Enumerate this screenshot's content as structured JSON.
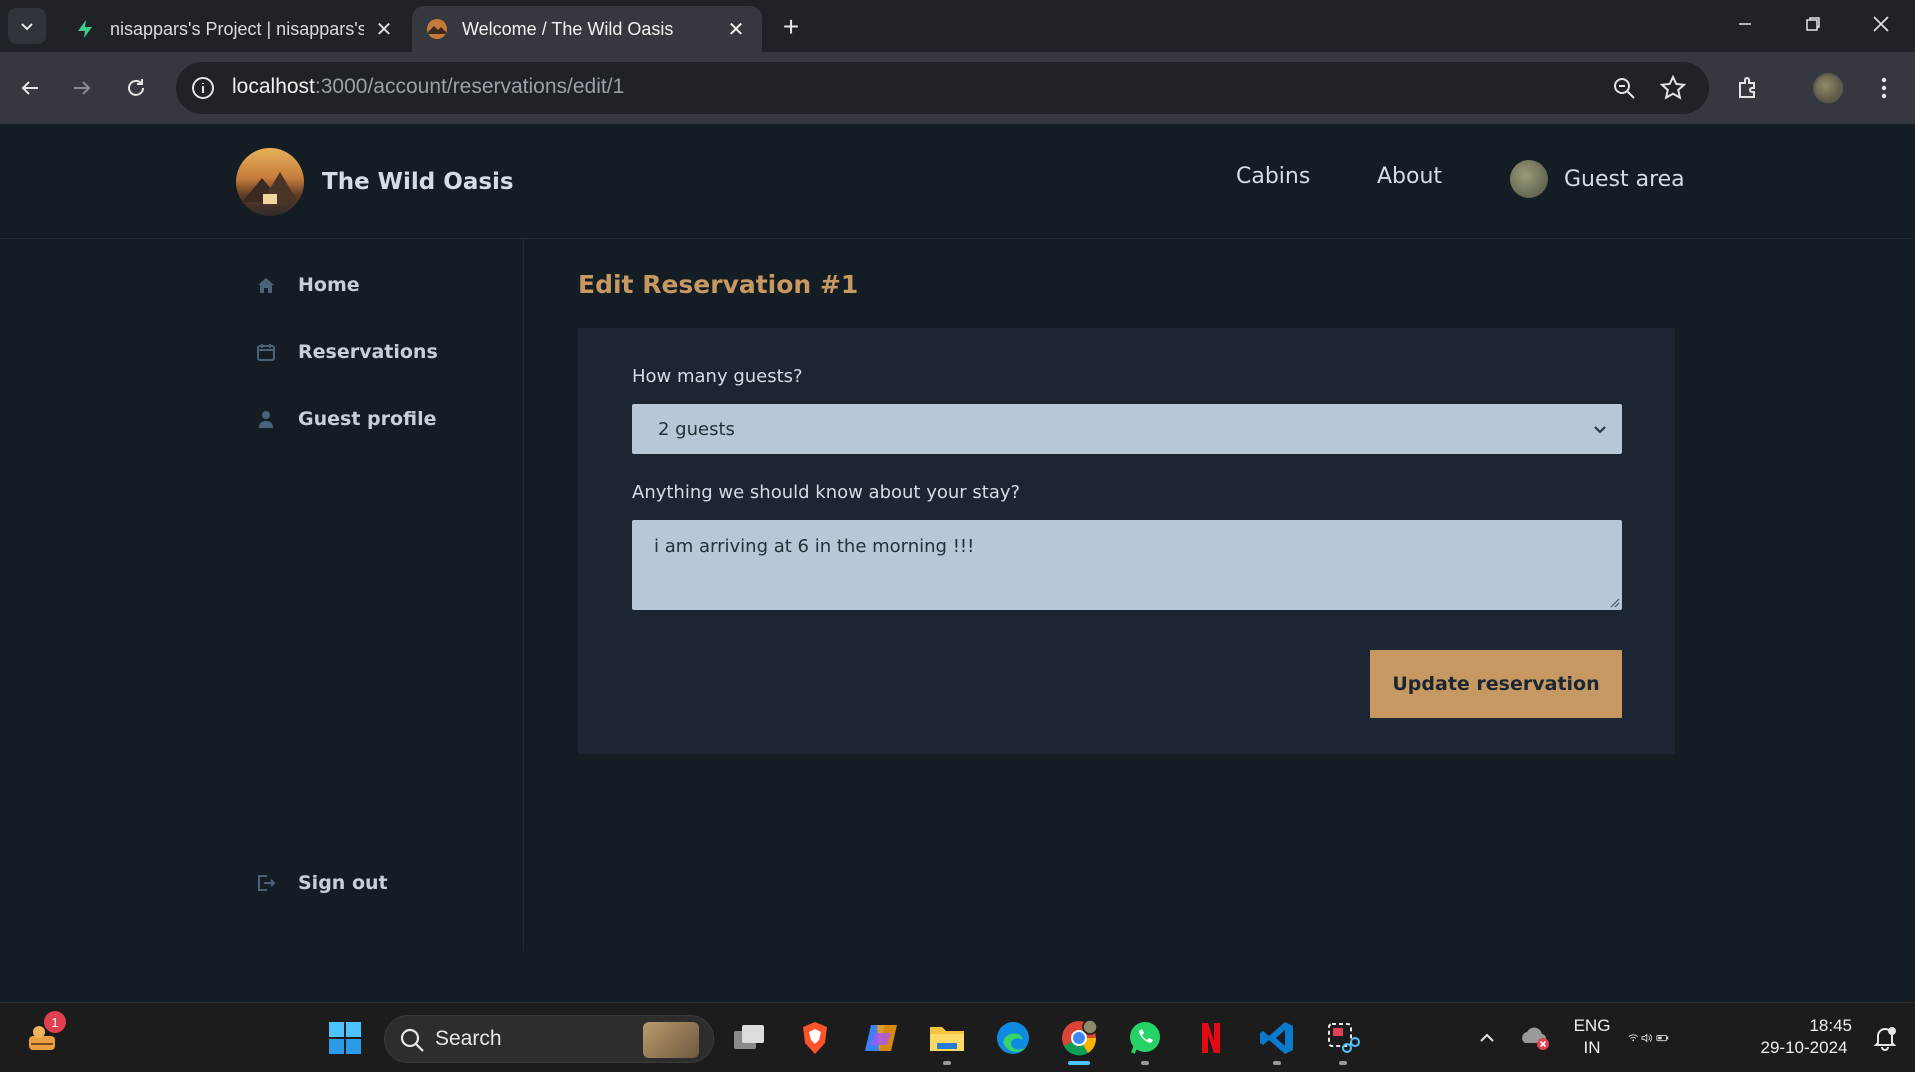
{
  "browser": {
    "tabs": [
      {
        "title": "nisappars's Project | nisappars's",
        "active": false
      },
      {
        "title": "Welcome / The Wild Oasis",
        "active": true
      }
    ],
    "url_host": "localhost",
    "url_path": ":3000/account/reservations/edit/1"
  },
  "site": {
    "logo_text": "The Wild Oasis",
    "nav": {
      "cabins": "Cabins",
      "about": "About",
      "guest_area": "Guest area"
    },
    "sidebar": {
      "home": "Home",
      "reservations": "Reservations",
      "guest_profile": "Guest profile",
      "sign_out": "Sign out"
    },
    "page_title": "Edit Reservation #1",
    "form": {
      "guests_label": "How many guests?",
      "guests_value": "2 guests",
      "observations_label": "Anything we should know about your stay?",
      "observations_value": "i am arriving at 6 in the morning !!!",
      "submit_label": "Update reservation"
    },
    "colors": {
      "accent": "#c69963",
      "background": "#141c24",
      "card": "#1b2632",
      "input": "#b7c7d7"
    }
  },
  "taskbar": {
    "search_label": "Search",
    "notification_count": "1",
    "language_line1": "ENG",
    "language_line2": "IN",
    "time": "18:45",
    "date": "29-10-2024"
  }
}
